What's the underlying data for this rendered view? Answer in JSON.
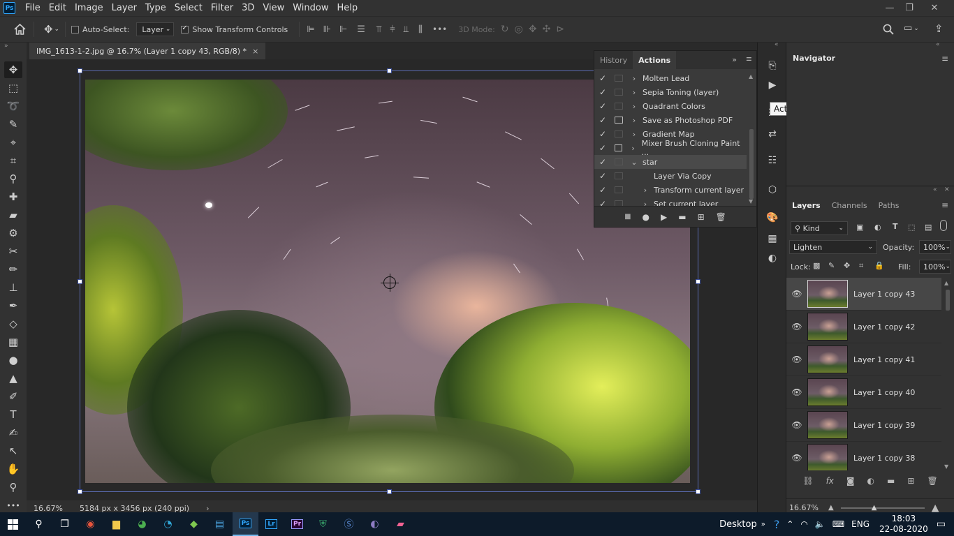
{
  "menubar": {
    "logo": "Ps",
    "items": [
      "File",
      "Edit",
      "Image",
      "Layer",
      "Type",
      "Select",
      "Filter",
      "3D",
      "View",
      "Window",
      "Help"
    ],
    "window_controls": [
      "—",
      "❐",
      "✕"
    ]
  },
  "options": {
    "auto_select_label": "Auto-Select:",
    "auto_select_checked": false,
    "target_value": "Layer",
    "show_transform_label": "Show Transform Controls",
    "show_transform_checked": true,
    "more": "•••",
    "mode_3d_label": "3D Mode:"
  },
  "document": {
    "tab_title": "IMG_1613-1-2.jpg @ 16.7% (Layer 1 copy 43, RGB/8) *",
    "close": "×",
    "zoom": "16.67%",
    "doc_info": "5184 px x 3456 px (240 ppi)",
    "arrow": "›"
  },
  "actions_panel": {
    "tabs": [
      "History",
      "Actions"
    ],
    "active_tab": "Actions",
    "rows": [
      {
        "label": "Molten Lead",
        "indent": 0,
        "expander": "›",
        "dialog": false
      },
      {
        "label": "Sepia Toning (layer)",
        "indent": 0,
        "expander": "›",
        "dialog": false
      },
      {
        "label": "Quadrant Colors",
        "indent": 0,
        "expander": "›",
        "dialog": false
      },
      {
        "label": "Save as Photoshop PDF",
        "indent": 0,
        "expander": "›",
        "dialog": true
      },
      {
        "label": "Gradient Map",
        "indent": 0,
        "expander": "›",
        "dialog": false
      },
      {
        "label": "Mixer Brush Cloning Paint ...",
        "indent": 0,
        "expander": "›",
        "dialog": true
      },
      {
        "label": "star",
        "indent": 0,
        "expander": "⌄",
        "dialog": false,
        "selected": true
      },
      {
        "label": "Layer Via Copy",
        "indent": 1,
        "expander": "",
        "dialog": false
      },
      {
        "label": "Transform current layer",
        "indent": 1,
        "expander": "›",
        "dialog": false
      },
      {
        "label": "Set current layer",
        "indent": 1,
        "expander": "›",
        "dialog": false
      }
    ]
  },
  "tooltip": "Actions",
  "navigator": {
    "title": "Navigator"
  },
  "layers_panel": {
    "tabs": [
      "Layers",
      "Channels",
      "Paths"
    ],
    "filter_kind": "Kind",
    "blend_mode": "Lighten",
    "opacity_label": "Opacity:",
    "opacity_value": "100%",
    "lock_label": "Lock:",
    "fill_label": "Fill:",
    "fill_value": "100%",
    "layers": [
      "Layer 1 copy 43",
      "Layer 1 copy 42",
      "Layer 1 copy 41",
      "Layer 1 copy 40",
      "Layer 1 copy 39",
      "Layer 1 copy 38"
    ],
    "selected_layer": "Layer 1 copy 43",
    "footer_fx": "fx"
  },
  "navigator_footer": {
    "zoom": "16.67%"
  },
  "taskbar": {
    "desktop_label": "Desktop",
    "language": "ENG",
    "time": "18:03",
    "date": "22-08-2020",
    "apps": [
      "Lr",
      "Pr"
    ]
  },
  "colors": {
    "accent": "#31a8ff",
    "selection_box": "#5a6ab0"
  }
}
